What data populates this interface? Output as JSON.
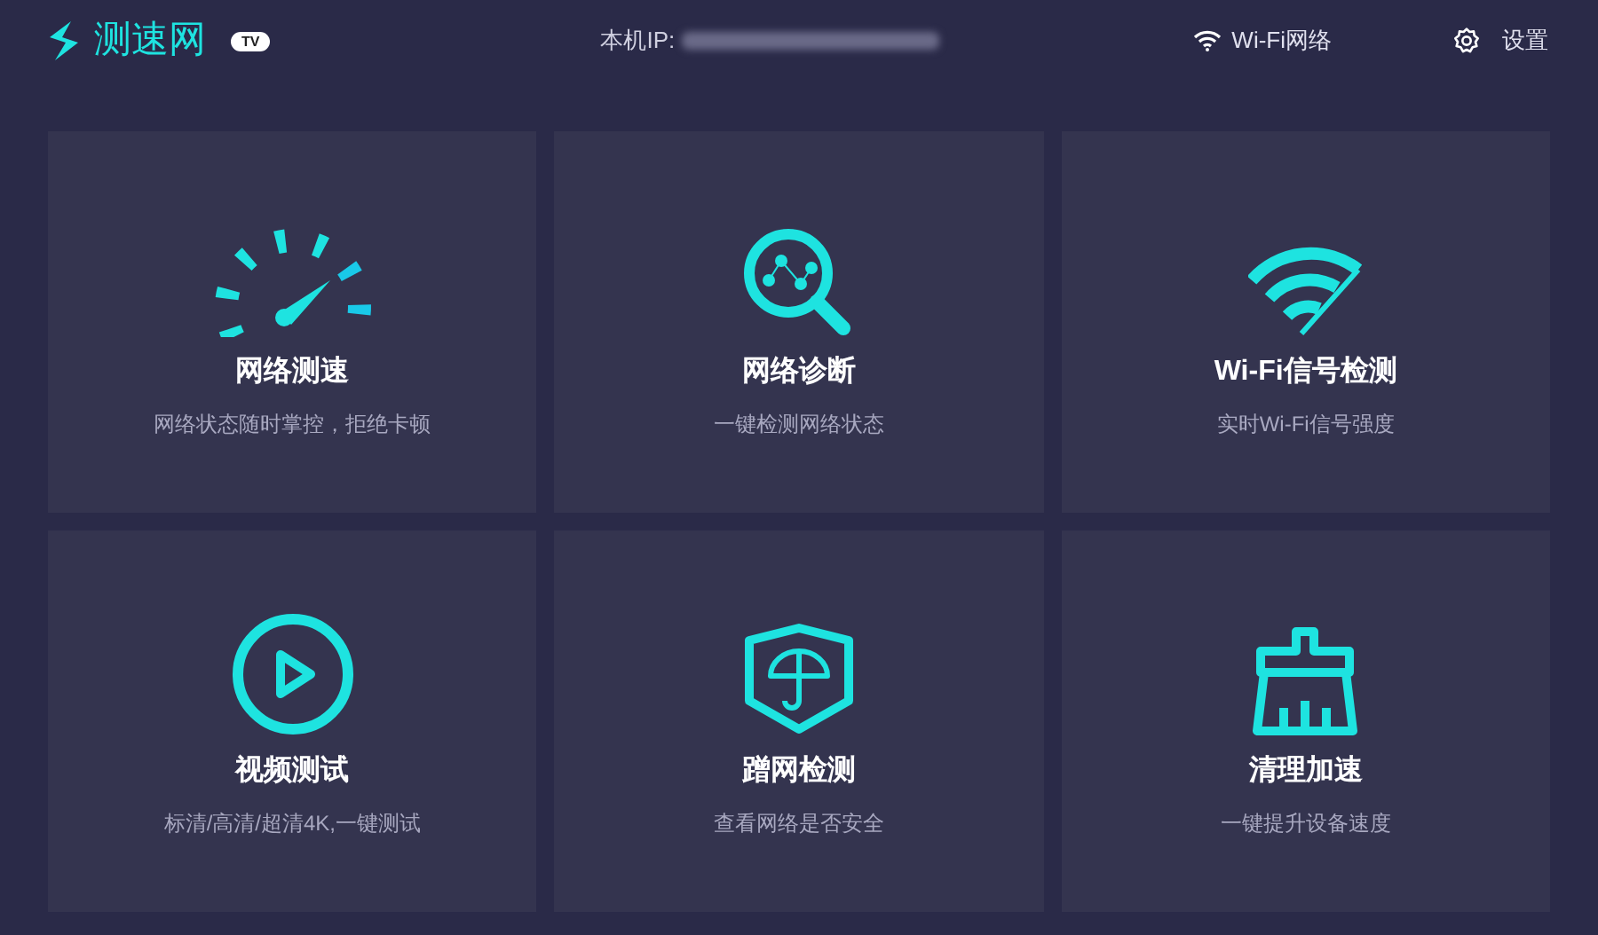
{
  "header": {
    "logo": "测速网",
    "badge": "TV",
    "ip_label": "本机IP:",
    "network": "Wi-Fi网络",
    "settings": "设置"
  },
  "cards": [
    {
      "kind": "speed",
      "title": "网络测速",
      "subtitle": "网络状态随时掌控，拒绝卡顿"
    },
    {
      "kind": "diagnose",
      "title": "网络诊断",
      "subtitle": "一键检测网络状态"
    },
    {
      "kind": "wifi",
      "title": "Wi-Fi信号检测",
      "subtitle": "实时Wi-Fi信号强度"
    },
    {
      "kind": "video",
      "title": "视频测试",
      "subtitle": "标清/高清/超清4K,一键测试"
    },
    {
      "kind": "security",
      "title": "蹭网检测",
      "subtitle": "查看网络是否安全"
    },
    {
      "kind": "clean",
      "title": "清理加速",
      "subtitle": "一键提升设备速度"
    }
  ]
}
